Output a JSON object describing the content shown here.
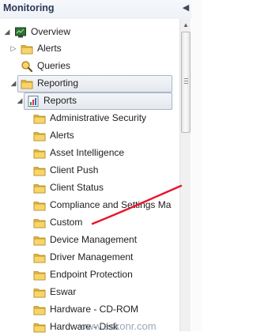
{
  "header": {
    "title": "Monitoring",
    "collapse_icon": "chevron-left-icon"
  },
  "tree": [
    {
      "label": "Overview",
      "icon": "overview-icon",
      "arrow": "expanded",
      "level": 0
    },
    {
      "label": "Alerts",
      "icon": "folder-icon",
      "arrow": "collapsed",
      "level": 1
    },
    {
      "label": "Queries",
      "icon": "queries-icon",
      "arrow": "none",
      "level": 1
    },
    {
      "label": "Reporting",
      "icon": "folder-icon",
      "arrow": "expanded",
      "level": 1,
      "selected": true
    },
    {
      "label": "Reports",
      "icon": "reports-icon",
      "arrow": "expanded",
      "level": 2,
      "selected": true
    },
    {
      "label": "Administrative Security",
      "icon": "folder-icon",
      "level": 3
    },
    {
      "label": "Alerts",
      "icon": "folder-icon",
      "level": 3
    },
    {
      "label": "Asset Intelligence",
      "icon": "folder-icon",
      "level": 3
    },
    {
      "label": "Client Push",
      "icon": "folder-icon",
      "level": 3
    },
    {
      "label": "Client Status",
      "icon": "folder-icon",
      "level": 3
    },
    {
      "label": "Compliance and Settings Ma",
      "icon": "folder-icon",
      "level": 3
    },
    {
      "label": "Custom",
      "icon": "folder-icon",
      "level": 3
    },
    {
      "label": "Device Management",
      "icon": "folder-icon",
      "level": 3
    },
    {
      "label": "Driver Management",
      "icon": "folder-icon",
      "level": 3
    },
    {
      "label": "Endpoint Protection",
      "icon": "folder-icon",
      "level": 3
    },
    {
      "label": "Eswar",
      "icon": "folder-icon",
      "level": 3
    },
    {
      "label": "Hardware - CD-ROM",
      "icon": "folder-icon",
      "level": 3
    },
    {
      "label": "Hardware - Disk",
      "icon": "folder-icon",
      "level": 3
    }
  ],
  "watermark": "www.eskonr.com",
  "colors": {
    "annotation": "#e8132a",
    "folder": "#f2c74a",
    "selection_border": "#a9b6c8"
  }
}
